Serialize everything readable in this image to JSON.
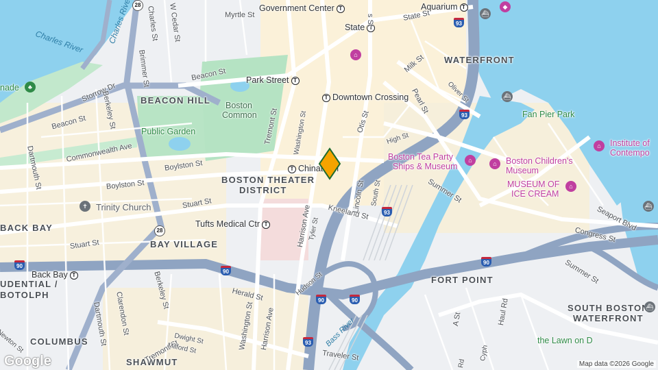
{
  "districts": {
    "beacon_hill": "BEACON HILL",
    "boston_theater_district": "BOSTON THEATER",
    "boston_theater_district_2": "DISTRICT",
    "back_bay": "BACK BAY",
    "bay_village": "BAY VILLAGE",
    "waterfront": "WATERFRONT",
    "fort_point": "FORT POINT",
    "south_boston_waterfront": "SOUTH BOSTON",
    "south_boston_waterfront_2": "WATERFRONT",
    "columbus": "COLUMBUS",
    "shawmut": "SHAWMUT",
    "prudential": "UDENTIAL /",
    "botolph": "BOTOLPH"
  },
  "water": {
    "charles_river": "Charles River",
    "charles_river_2": "Charles Rive",
    "bass_river": "Bass River"
  },
  "places": {
    "government_center": "Government Center",
    "state": "State",
    "state_st": "State St",
    "aquarium": "Aquarium",
    "park_street": "Park Street",
    "downtown_crossing": "Downtown Crossing",
    "chinatown": "Chinatown",
    "boston_common": "Boston",
    "boston_common_2": "Common",
    "public_garden": "Public Garden",
    "trinity_church": "Trinity Church",
    "tufts_medical": "Tufts Medical Ctr",
    "back_bay_station": "Back Bay",
    "boston_tea_party": "Boston Tea Party",
    "boston_tea_party_2": "Ships & Museum",
    "boston_childrens": "Boston Children's",
    "boston_childrens_2": "Museum",
    "museum_ice_cream": "MUSEUM OF",
    "museum_ice_cream_2": "ICE CREAM",
    "institute": "Institute of",
    "institute_2": "Contempo",
    "fan_pier_park": "Fan Pier Park",
    "lawn_on_d": "the Lawn on D",
    "esplanade": "nade"
  },
  "streets": {
    "myrtle": "Myrtle St",
    "charles": "Charles St",
    "w_cedar": "W Cedar St",
    "brimmer": "Brimmer St",
    "beacon_1": "Beacon St",
    "beacon_2": "Beacon St",
    "storrow": "Storrow Dr",
    "berkeley_1": "Berkeley St",
    "berkeley_2": "Berkeley St",
    "dartmouth_1": "Dartmouth St",
    "dartmouth_2": "Dartmouth St",
    "commonwealth": "Commonwealth Ave",
    "boylston_1": "Boylston St",
    "boylston_2": "Boylston St",
    "stuart_1": "Stuart St",
    "stuart_2": "Stuart St",
    "clarendon": "Clarendon St",
    "tremont_1": "Tremont St",
    "tremont_2": "Tremont St",
    "washington_1": "Washington St",
    "washington_2": "Washington St",
    "harrison_1": "Harrison Ave",
    "harrison_2": "Harrison Ave",
    "tyler": "Tyler St",
    "hudson": "Hudson St",
    "kneeland": "Kneeland St",
    "lincoln": "Lincoln St",
    "south": "South St",
    "otis": "Otis St",
    "high": "High St",
    "milk": "Milk St",
    "pearl": "Pearl St",
    "oliver": "Oliver St",
    "summer_1": "Summer St",
    "summer_2": "Summer St",
    "congress": "Congress St",
    "seaport": "Seaport Blvd",
    "a_st": "A St",
    "haul": "Haul Rd",
    "herald": "Herald St",
    "traveler": "Traveler St",
    "dwight": "Dwight St",
    "milford": "Milford St",
    "newton": "Newton St",
    "cyph": "Cyph",
    "rd": "Rd",
    "s_st": "s St"
  },
  "shields": {
    "i93": "93",
    "i90": "90",
    "rt28": "28"
  },
  "transit_symbol": "T",
  "branding": {
    "logo": "Google",
    "attribution": "Map data ©2026 Google"
  },
  "colors": {
    "water": "#8ed1ee",
    "park": "#b5e3c3",
    "highway": "#8fa4c2",
    "major_road": "#ffffff",
    "district_fill": "#fbf2dc",
    "marker": "#f5a300",
    "poi": "#c03fa0"
  }
}
